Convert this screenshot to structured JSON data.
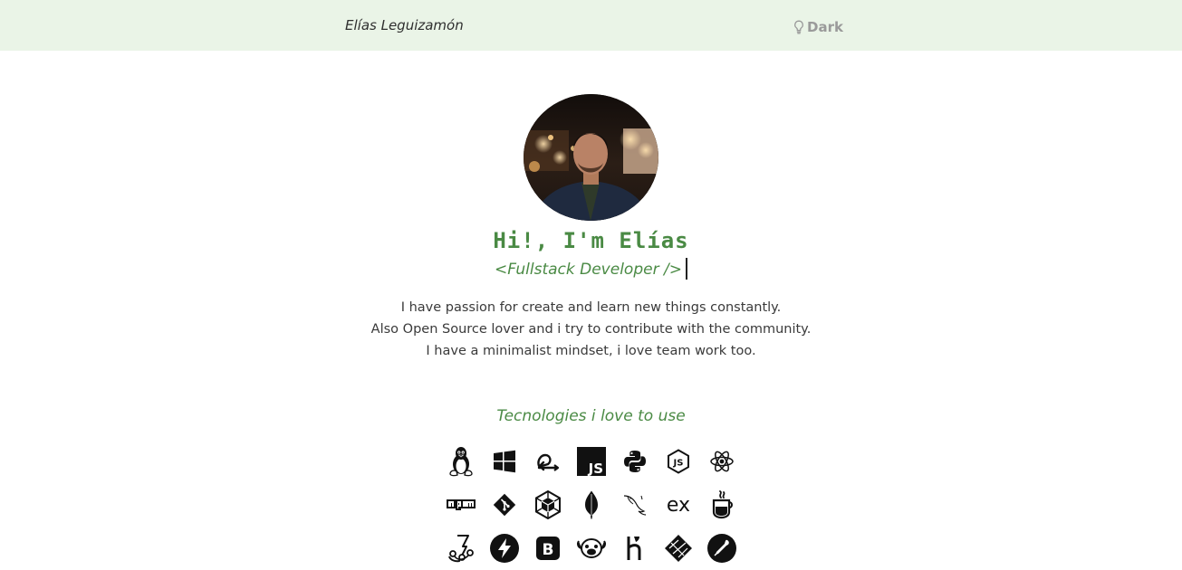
{
  "header": {
    "brand": "Elías Leguizamón",
    "theme_toggle_label": "Dark"
  },
  "hero": {
    "greeting": "Hi!, I'm Elías",
    "role": "<Fullstack Developer />",
    "bio": [
      "I have passion for create and learn new things constantly.",
      "Also Open Source lover and i try to contribute with the community.",
      "I have a minimalist mindset, i love team work too."
    ]
  },
  "technologies": {
    "title": "Tecnologies i love to use",
    "icons": [
      "linux-icon",
      "windows-icon",
      "scrum-icon",
      "javascript-icon",
      "python-icon",
      "nodejs-icon",
      "react-icon",
      "npm-icon",
      "git-icon",
      "webpack-icon",
      "mongodb-icon",
      "mysql-icon",
      "express-icon",
      "java-icon",
      "jest-icon",
      "fastify-icon",
      "bootstrap-icon",
      "pug-icon",
      "heroku-icon",
      "netlify-icon",
      "postman-icon"
    ]
  },
  "colors": {
    "accent_green": "#4a8a44",
    "header_bg": "#eaf4e7"
  }
}
